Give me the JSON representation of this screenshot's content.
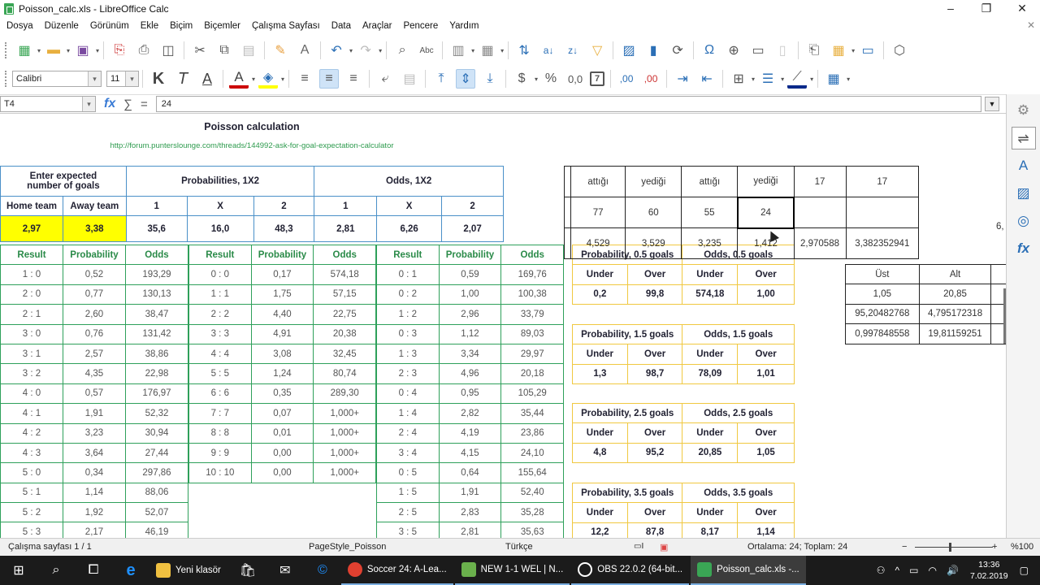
{
  "window": {
    "title": "Poisson_calc.xls - LibreOffice Calc",
    "controls": {
      "minimize": "–",
      "maximize": "❐",
      "close": "✕"
    }
  },
  "menu": {
    "items": [
      "Dosya",
      "Düzenle",
      "Görünüm",
      "Ekle",
      "Biçim",
      "Biçemler",
      "Çalışma Sayfası",
      "Data",
      "Araçlar",
      "Pencere",
      "Yardım"
    ],
    "close": "✕"
  },
  "toolbar2": {
    "font_name": "Calibri",
    "font_size": "11",
    "bold": "K",
    "italic": "T",
    "underline": "A",
    "currency": "$",
    "percent": "%",
    "number": "0,0",
    "date": "7",
    "add_decimal": ",00",
    "del_decimal": ",00"
  },
  "formula_bar": {
    "cell_ref": "T4",
    "fx": "fx",
    "sigma": "∑",
    "equals": "=",
    "content": "24"
  },
  "sheet": {
    "title": "Poisson calculation",
    "link": "http://forum.punterslounge.com/threads/144992-ask-for-goal-expectation-calculator",
    "top_table": {
      "header_expected": "Enter expected number of goals",
      "header_prob": "Probabilities, 1X2",
      "header_odds": "Odds, 1X2",
      "subheaders": [
        "Home team",
        "Away team",
        "1",
        "X",
        "2",
        "1",
        "X",
        "2"
      ],
      "values": [
        "2,97",
        "3,38",
        "35,6",
        "16,0",
        "48,3",
        "2,81",
        "6,26",
        "2,07"
      ]
    },
    "result_tables": {
      "headers": [
        "Result",
        "Probability",
        "Odds"
      ],
      "home": [
        [
          "1  :  0",
          "0,52",
          "193,29"
        ],
        [
          "2  :  0",
          "0,77",
          "130,13"
        ],
        [
          "2  :  1",
          "2,60",
          "38,47"
        ],
        [
          "3  :  0",
          "0,76",
          "131,42"
        ],
        [
          "3  :  1",
          "2,57",
          "38,86"
        ],
        [
          "3  :  2",
          "4,35",
          "22,98"
        ],
        [
          "4  :  0",
          "0,57",
          "176,97"
        ],
        [
          "4  :  1",
          "1,91",
          "52,32"
        ],
        [
          "4  :  2",
          "3,23",
          "30,94"
        ],
        [
          "4  :  3",
          "3,64",
          "27,44"
        ],
        [
          "5  :  0",
          "0,34",
          "297,86"
        ],
        [
          "5  :  1",
          "1,14",
          "88,06"
        ],
        [
          "5  :  2",
          "1,92",
          "52,07"
        ],
        [
          "5  :  3",
          "2,17",
          "46,19"
        ]
      ],
      "draw": [
        [
          "0  :  0",
          "0,17",
          "574,18"
        ],
        [
          "1  :  1",
          "1,75",
          "57,15"
        ],
        [
          "2  :  2",
          "4,40",
          "22,75"
        ],
        [
          "3  :  3",
          "4,91",
          "20,38"
        ],
        [
          "4  :  4",
          "3,08",
          "32,45"
        ],
        [
          "5  :  5",
          "1,24",
          "80,74"
        ],
        [
          "6  :  6",
          "0,35",
          "289,30"
        ],
        [
          "7  :  7",
          "0,07",
          "1,000+"
        ],
        [
          "8  :  8",
          "0,01",
          "1,000+"
        ],
        [
          "9  :  9",
          "0,00",
          "1,000+"
        ],
        [
          "10  :  10",
          "0,00",
          "1,000+"
        ]
      ],
      "away": [
        [
          "0  :  1",
          "0,59",
          "169,76"
        ],
        [
          "0  :  2",
          "1,00",
          "100,38"
        ],
        [
          "1  :  2",
          "2,96",
          "33,79"
        ],
        [
          "0  :  3",
          "1,12",
          "89,03"
        ],
        [
          "1  :  3",
          "3,34",
          "29,97"
        ],
        [
          "2  :  3",
          "4,96",
          "20,18"
        ],
        [
          "0  :  4",
          "0,95",
          "105,29"
        ],
        [
          "1  :  4",
          "2,82",
          "35,44"
        ],
        [
          "2  :  4",
          "4,19",
          "23,86"
        ],
        [
          "3  :  4",
          "4,15",
          "24,10"
        ],
        [
          "0  :  5",
          "0,64",
          "155,64"
        ],
        [
          "1  :  5",
          "1,91",
          "52,40"
        ],
        [
          "2  :  5",
          "2,83",
          "35,28"
        ],
        [
          "3  :  5",
          "2,81",
          "35,63"
        ]
      ]
    },
    "goals_tables": [
      {
        "prob_header": "Probability, 0.5 goals",
        "odds_header": "Odds, 0.5 goals",
        "sub": [
          "Under",
          "Over",
          "Under",
          "Over"
        ],
        "values": [
          "0,2",
          "99,8",
          "574,18",
          "1,00"
        ]
      },
      {
        "prob_header": "Probability, 1.5 goals",
        "odds_header": "Odds, 1.5 goals",
        "sub": [
          "Under",
          "Over",
          "Under",
          "Over"
        ],
        "values": [
          "1,3",
          "98,7",
          "78,09",
          "1,01"
        ]
      },
      {
        "prob_header": "Probability, 2.5 goals",
        "odds_header": "Odds, 2.5 goals",
        "sub": [
          "Under",
          "Over",
          "Under",
          "Over"
        ],
        "values": [
          "4,8",
          "95,2",
          "20,85",
          "1,05"
        ]
      },
      {
        "prob_header": "Probability, 3.5 goals",
        "odds_header": "Odds, 3.5 goals",
        "sub": [
          "Under",
          "Over",
          "Under",
          "Over"
        ],
        "values": [
          "12,2",
          "87,8",
          "8,17",
          "1,14"
        ]
      }
    ],
    "stats_table": {
      "row1": [
        "attığı",
        "yediği",
        "attığı",
        "yediği",
        "17",
        "17"
      ],
      "row2": [
        "77",
        "60",
        "55",
        "24",
        "",
        ""
      ],
      "row3": [
        "4,529",
        "3,529",
        "3,235",
        "1,412",
        "2,970588",
        "3,382352941"
      ],
      "overflow": "6,"
    },
    "ust_alt_table": {
      "headers": [
        "Üst",
        "Alt"
      ],
      "rows": [
        [
          "1,05",
          "20,85"
        ],
        [
          "95,20482768",
          "4,795172318"
        ],
        [
          "0,997848558",
          "19,81159251"
        ]
      ]
    }
  },
  "statusbar": {
    "sheet": "Çalışma sayfası 1 / 1",
    "page_style": "PageStyle_Poisson",
    "language": "Türkçe",
    "summary": "Ortalama: 24; Toplam: 24",
    "zoom": "%100",
    "zoom_minus": "−",
    "zoom_plus": "+"
  },
  "taskbar": {
    "apps": [
      {
        "label": "Yeni klasör",
        "color": "#f0c040"
      },
      {
        "label": "Soccer 24: A-Lea...",
        "color": "#e04030"
      },
      {
        "label": "NEW 1-1 WEL | N...",
        "color": "#6ab04c"
      },
      {
        "label": "OBS 22.0.2 (64-bit...",
        "color": "#333333"
      },
      {
        "label": "Poisson_calc.xls -...",
        "color": "#3aa655"
      }
    ],
    "time": "13:36",
    "date": "7.02.2019"
  }
}
